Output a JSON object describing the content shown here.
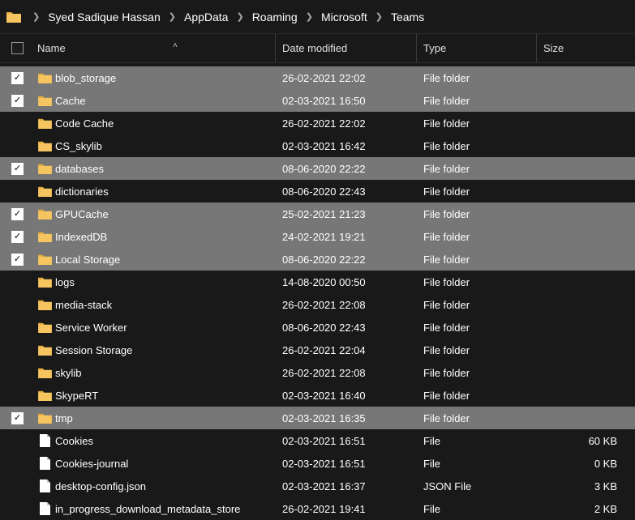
{
  "breadcrumbs": [
    "Syed Sadique Hassan",
    "AppData",
    "Roaming",
    "Microsoft",
    "Teams"
  ],
  "columns": {
    "name": "Name",
    "date": "Date modified",
    "type": "Type",
    "size": "Size"
  },
  "rows": [
    {
      "name": "blob_storage",
      "date": "26-02-2021 22:02",
      "type": "File folder",
      "size": "",
      "selected": true,
      "icon": "folder"
    },
    {
      "name": "Cache",
      "date": "02-03-2021 16:50",
      "type": "File folder",
      "size": "",
      "selected": true,
      "icon": "folder"
    },
    {
      "name": "Code Cache",
      "date": "26-02-2021 22:02",
      "type": "File folder",
      "size": "",
      "selected": false,
      "icon": "folder"
    },
    {
      "name": "CS_skylib",
      "date": "02-03-2021 16:42",
      "type": "File folder",
      "size": "",
      "selected": false,
      "icon": "folder"
    },
    {
      "name": "databases",
      "date": "08-06-2020 22:22",
      "type": "File folder",
      "size": "",
      "selected": true,
      "icon": "folder"
    },
    {
      "name": "dictionaries",
      "date": "08-06-2020 22:43",
      "type": "File folder",
      "size": "",
      "selected": false,
      "icon": "folder"
    },
    {
      "name": "GPUCache",
      "date": "25-02-2021 21:23",
      "type": "File folder",
      "size": "",
      "selected": true,
      "icon": "folder"
    },
    {
      "name": "IndexedDB",
      "date": "24-02-2021 19:21",
      "type": "File folder",
      "size": "",
      "selected": true,
      "icon": "folder"
    },
    {
      "name": "Local Storage",
      "date": "08-06-2020 22:22",
      "type": "File folder",
      "size": "",
      "selected": true,
      "icon": "folder"
    },
    {
      "name": "logs",
      "date": "14-08-2020 00:50",
      "type": "File folder",
      "size": "",
      "selected": false,
      "icon": "folder"
    },
    {
      "name": "media-stack",
      "date": "26-02-2021 22:08",
      "type": "File folder",
      "size": "",
      "selected": false,
      "icon": "folder"
    },
    {
      "name": "Service Worker",
      "date": "08-06-2020 22:43",
      "type": "File folder",
      "size": "",
      "selected": false,
      "icon": "folder"
    },
    {
      "name": "Session Storage",
      "date": "26-02-2021 22:04",
      "type": "File folder",
      "size": "",
      "selected": false,
      "icon": "folder"
    },
    {
      "name": "skylib",
      "date": "26-02-2021 22:08",
      "type": "File folder",
      "size": "",
      "selected": false,
      "icon": "folder"
    },
    {
      "name": "SkypeRT",
      "date": "02-03-2021 16:40",
      "type": "File folder",
      "size": "",
      "selected": false,
      "icon": "folder"
    },
    {
      "name": "tmp",
      "date": "02-03-2021 16:35",
      "type": "File folder",
      "size": "",
      "selected": true,
      "icon": "folder"
    },
    {
      "name": "Cookies",
      "date": "02-03-2021 16:51",
      "type": "File",
      "size": "60 KB",
      "selected": false,
      "icon": "file"
    },
    {
      "name": "Cookies-journal",
      "date": "02-03-2021 16:51",
      "type": "File",
      "size": "0 KB",
      "selected": false,
      "icon": "file"
    },
    {
      "name": "desktop-config.json",
      "date": "02-03-2021 16:37",
      "type": "JSON File",
      "size": "3 KB",
      "selected": false,
      "icon": "file"
    },
    {
      "name": "in_progress_download_metadata_store",
      "date": "26-02-2021 19:41",
      "type": "File",
      "size": "2 KB",
      "selected": false,
      "icon": "file"
    }
  ]
}
